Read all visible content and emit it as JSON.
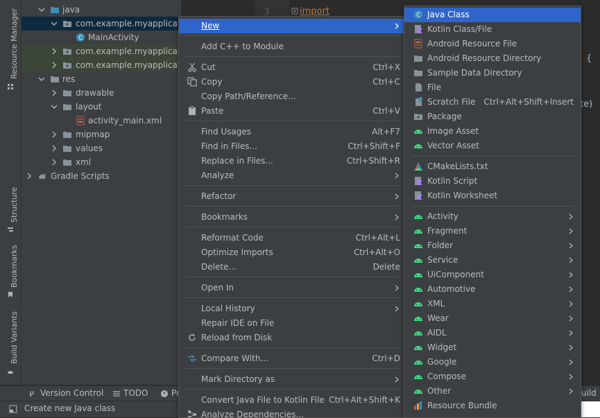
{
  "sidebar": {
    "resource_manager": "Resource Manager",
    "structure": "Structure",
    "bookmarks": "Bookmarks",
    "build_variants": "Build Variants"
  },
  "tree": {
    "java": "java",
    "pkg_main": "com.example.myapplication",
    "main_activity": "MainActivity",
    "pkg_android_test": "com.example.myapplication",
    "pkg_test": "com.example.myapplication",
    "res": "res",
    "drawable": "drawable",
    "layout": "layout",
    "activity_main": "activity_main.xml",
    "mipmap": "mipmap",
    "values": "values",
    "xml": "xml",
    "gradle_scripts": "Gradle Scripts"
  },
  "editor": {
    "line_number": "3",
    "code_import": "import",
    "code_brace": "{",
    "code_paren": "te)"
  },
  "context_menu": {
    "new": "New",
    "add_cpp": "Add C++ to Module",
    "cut": "Cut",
    "cut_sc": "Ctrl+X",
    "copy": "Copy",
    "copy_sc": "Ctrl+C",
    "copy_path": "Copy Path/Reference...",
    "paste": "Paste",
    "paste_sc": "Ctrl+V",
    "find_usages": "Find Usages",
    "find_usages_sc": "Alt+F7",
    "find_in_files": "Find in Files...",
    "find_in_files_sc": "Ctrl+Shift+F",
    "replace_in_files": "Replace in Files...",
    "replace_in_files_sc": "Ctrl+Shift+R",
    "analyze": "Analyze",
    "refactor": "Refactor",
    "bookmarks": "Bookmarks",
    "reformat": "Reformat Code",
    "reformat_sc": "Ctrl+Alt+L",
    "optimize": "Optimize Imports",
    "optimize_sc": "Ctrl+Alt+O",
    "delete": "Delete...",
    "delete_sc": "Delete",
    "open_in": "Open In",
    "local_history": "Local History",
    "repair_ide": "Repair IDE on File",
    "reload": "Reload from Disk",
    "compare": "Compare With...",
    "compare_sc": "Ctrl+D",
    "mark_dir": "Mark Directory as",
    "convert": "Convert Java File to Kotlin File",
    "convert_sc": "Ctrl+Alt+Shift+K",
    "analyze_deps": "Analyze Dependencies..."
  },
  "new_submenu": {
    "java_class": "Java Class",
    "kotlin_class": "Kotlin Class/File",
    "android_resource_file": "Android Resource File",
    "android_resource_dir": "Android Resource Directory",
    "sample_data_dir": "Sample Data Directory",
    "file": "File",
    "scratch_file": "Scratch File",
    "scratch_file_sc": "Ctrl+Alt+Shift+Insert",
    "package": "Package",
    "image_asset": "Image Asset",
    "vector_asset": "Vector Asset",
    "cmakelists": "CMakeLists.txt",
    "kotlin_script": "Kotlin Script",
    "kotlin_worksheet": "Kotlin Worksheet",
    "activity": "Activity",
    "fragment": "Fragment",
    "folder": "Folder",
    "service": "Service",
    "uicomponent": "UiComponent",
    "automotive": "Automotive",
    "xml": "XML",
    "wear": "Wear",
    "aidl": "AIDL",
    "widget": "Widget",
    "google": "Google",
    "compose": "Compose",
    "other": "Other",
    "resource_bundle": "Resource Bundle"
  },
  "bottom": {
    "version_control": "Version Control",
    "todo": "TODO",
    "problems": "Pr",
    "build": "uild",
    "status": "Create new Java class"
  },
  "colors": {
    "panel": "#3c3f41",
    "editor": "#2b2b2b",
    "selection": "#2f65ca",
    "folder": "#87939a",
    "android": "#3ddc84",
    "java_class": "#3d8eb9"
  }
}
